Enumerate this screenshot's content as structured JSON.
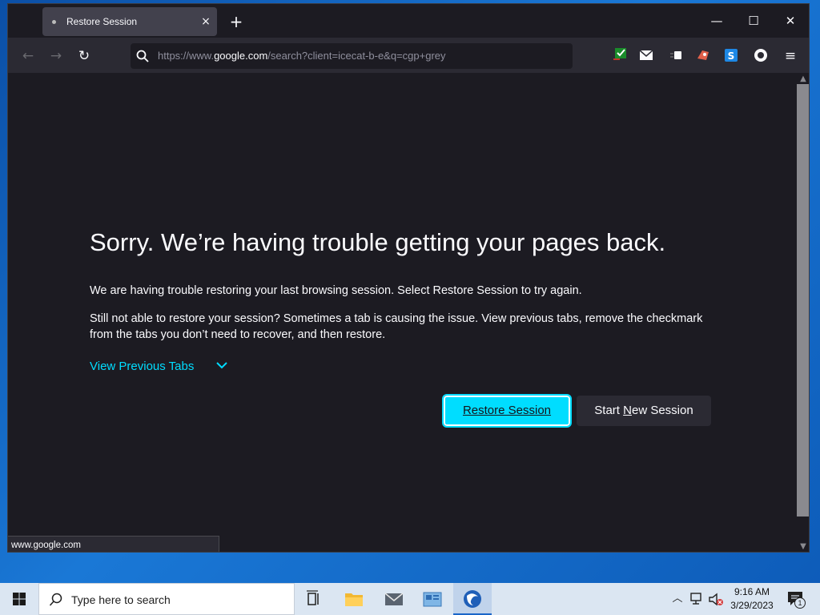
{
  "browser": {
    "tab": {
      "title": "Restore Session",
      "close": "×"
    },
    "new_tab": "+",
    "window_controls": {
      "minimize": "—",
      "maximize": "☐",
      "close": "✕"
    },
    "nav": {
      "back": "←",
      "forward": "→",
      "reload": "↻"
    },
    "url": {
      "prefix": "https://www.",
      "host": "google.com",
      "path": "/search?client=icecat-b-e&q=cgp+grey"
    },
    "menu": "≡",
    "toolbar_icons": [
      "checkmark-extension-icon",
      "mail-icon",
      "extension-icon",
      "bug-extension-icon",
      "s-extension-icon",
      "circle-extension-icon"
    ],
    "status_url": "www.google.com",
    "scroll": {
      "up": "▲",
      "down": "▼"
    }
  },
  "page": {
    "heading": "Sorry. We’re having trouble getting your pages back.",
    "para1": "We are having trouble restoring your last browsing session. Select Restore Session to try again.",
    "para2": "Still not able to restore your session? Sometimes a tab is causing the issue. View previous tabs, remove the checkmark from the tabs you don’t need to recover, and then restore.",
    "view_tabs": "View Previous Tabs",
    "restore_button": "Restore Session",
    "new_session_button": {
      "before": "Start ",
      "accel": "N",
      "after": "ew Session"
    }
  },
  "taskbar": {
    "search_placeholder": "Type here to search",
    "time": "9:16 AM",
    "date": "3/29/2023",
    "notification_count": "1"
  },
  "colors": {
    "accent": "#00ddff",
    "background": "#1c1b22",
    "toolbar": "#2b2a33"
  }
}
